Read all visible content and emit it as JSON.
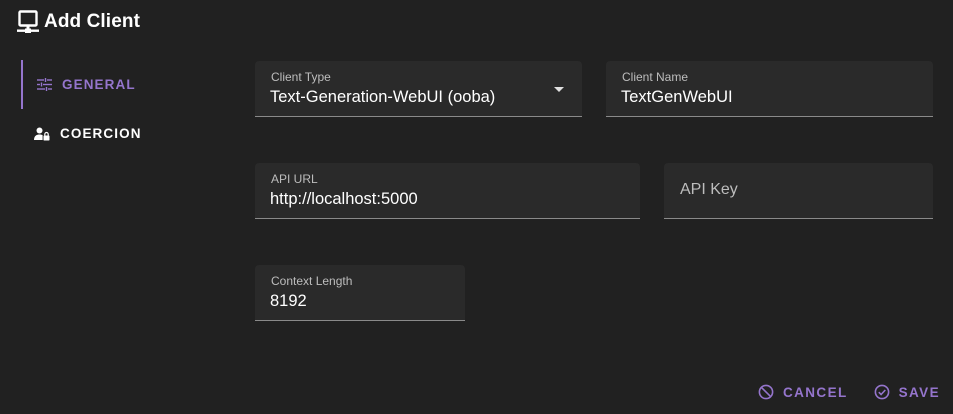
{
  "dialog": {
    "title": "Add Client",
    "title_icon": "desktop-network-icon"
  },
  "sidebar": {
    "tabs": [
      {
        "label": "GENERAL",
        "icon": "tune-icon",
        "active": true
      },
      {
        "label": "COERCION",
        "icon": "account-lock-icon",
        "active": false
      }
    ]
  },
  "form": {
    "client_type": {
      "label": "Client Type",
      "value": "Text-Generation-WebUI (ooba)"
    },
    "client_name": {
      "label": "Client Name",
      "value": "TextGenWebUI"
    },
    "api_url": {
      "label": "API URL",
      "value": "http://localhost:5000"
    },
    "api_key": {
      "label": "API Key",
      "value": ""
    },
    "context_length": {
      "label": "Context Length",
      "value": "8192"
    }
  },
  "actions": {
    "cancel_label": "CANCEL",
    "save_label": "SAVE"
  },
  "colors": {
    "background": "#212121",
    "field_background": "#2a2a2a",
    "accent": "#9575cd"
  }
}
